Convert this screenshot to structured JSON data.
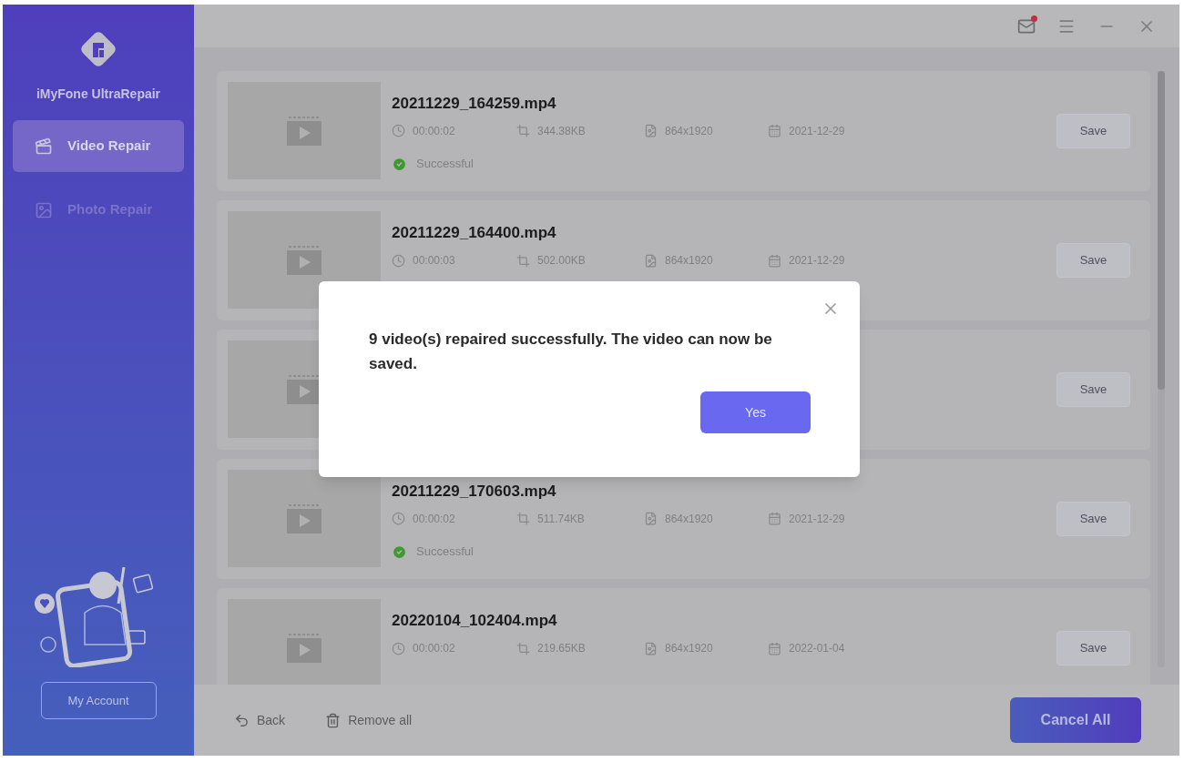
{
  "app": {
    "name": "iMyFone UltraRepair"
  },
  "sidebar": {
    "items": [
      {
        "label": "Video Repair",
        "kind": "video",
        "selected": true
      },
      {
        "label": "Photo Repair",
        "kind": "photo",
        "selected": false
      }
    ],
    "account_button": "My Account"
  },
  "title_bar": {
    "notification": true
  },
  "videos": [
    {
      "name": "20211229_164259.mp4",
      "duration": "00:00:02",
      "size": "344.38KB",
      "resolution": "864x1920",
      "date": "2021-12-29",
      "status": "Successful",
      "action": "Save"
    },
    {
      "name": "20211229_164400.mp4",
      "duration": "00:00:03",
      "size": "502.00KB",
      "resolution": "864x1920",
      "date": "2021-12-29",
      "action": "Save"
    },
    {
      "action": "Save"
    },
    {
      "name": "20211229_170603.mp4",
      "duration": "00:00:02",
      "size": "511.74KB",
      "resolution": "864x1920",
      "date": "2021-12-29",
      "status": "Successful",
      "action": "Save"
    },
    {
      "name": "20220104_102404.mp4",
      "duration": "00:00:02",
      "size": "219.65KB",
      "resolution": "864x1920",
      "date": "2022-01-04",
      "action": "Save"
    }
  ],
  "footer": {
    "back": "Back",
    "remove_all": "Remove all",
    "cancel_all": "Cancel All"
  },
  "dialog": {
    "message": "9 video(s) repaired successfully. The video can now be saved.",
    "confirm": "Yes"
  }
}
